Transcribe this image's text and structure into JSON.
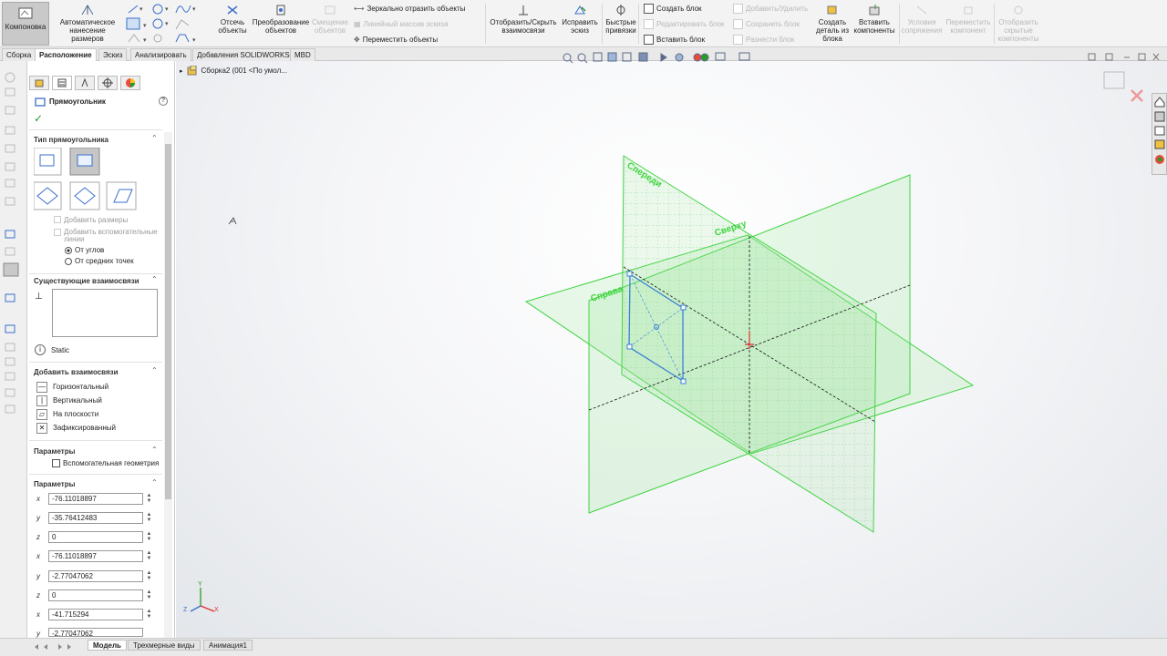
{
  "ribbon": {
    "layout_button": "Компоновка",
    "auto_dimension": "Автоматическое нанесение размеров",
    "trim": "Отсечь объекты",
    "convert": "Преобразование объектов",
    "offset": "Смещение объектов",
    "mirror": "Зеркально отразить объекты",
    "linear_pattern": "Линейный массив эскиза",
    "move": "Переместить объекты",
    "show_hide_relations": "Отобразить/Скрыть взаимосвязи",
    "repair_sketch": "Исправить эскиз",
    "quick_snaps": "Быстрые привязки",
    "create_block": "Создать блок",
    "edit_block": "Редактировать блок",
    "insert_block": "Вставить блок",
    "add_remove": "Добавить/Удалить",
    "save_block": "Сохранить блок",
    "explode_block": "Разнести блок",
    "make_part_from_block": "Создать деталь из блока",
    "insert_components": "Вставить компоненты",
    "mate_conditions": "Условия сопряжения",
    "move_component": "Переместить компонент",
    "show_hidden": "Отобразить скрытые компоненты"
  },
  "tabs": [
    "Сборка",
    "Расположение",
    "Эскиз",
    "Анализировать",
    "Добавления SOLIDWORKS",
    "MBD"
  ],
  "active_tab": "Расположение",
  "tree": {
    "root": "Сборка2  (001 <По умол..."
  },
  "pm": {
    "title": "Прямоугольник",
    "rect_type_head": "Тип прямоугольника",
    "add_dimensions": "Добавить размеры",
    "add_construction": "Добавить вспомогательные линии",
    "from_corners": "От углов",
    "from_midpoints": "От средних точек",
    "existing_relations_head": "Существующие взаимосвязи",
    "status": "Static",
    "add_relations_head": "Добавить взаимосвязи",
    "relations": [
      "Горизонтальный",
      "Вертикальный",
      "На плоскости",
      "Зафиксированный"
    ],
    "params_head_1": "Параметры",
    "construction_geometry": "Вспомогательная геометрия",
    "params_head_2": "Параметры",
    "fields": [
      {
        "label": "x",
        "value": "-76.11018897"
      },
      {
        "label": "y",
        "value": "-35.76412483"
      },
      {
        "label": "z",
        "value": "0"
      },
      {
        "label": "x",
        "value": "-76.11018897"
      },
      {
        "label": "y",
        "value": "-2.77047062"
      },
      {
        "label": "z",
        "value": "0"
      },
      {
        "label": "x",
        "value": "-41.715294"
      },
      {
        "label": "y",
        "value": "-2.77047062"
      }
    ]
  },
  "viewport": {
    "plane_front": "Спереди",
    "plane_top": "Сверху",
    "plane_right": "Справа",
    "triad_x": "X",
    "triad_y": "Y",
    "triad_z": "Z"
  },
  "bottom_tabs": [
    "Модель",
    "Трехмерные виды",
    "Анимация1"
  ],
  "colors": {
    "plane": "#3ed43e",
    "sketch": "#3b7ed6",
    "active_button": "#c9c9c9"
  }
}
